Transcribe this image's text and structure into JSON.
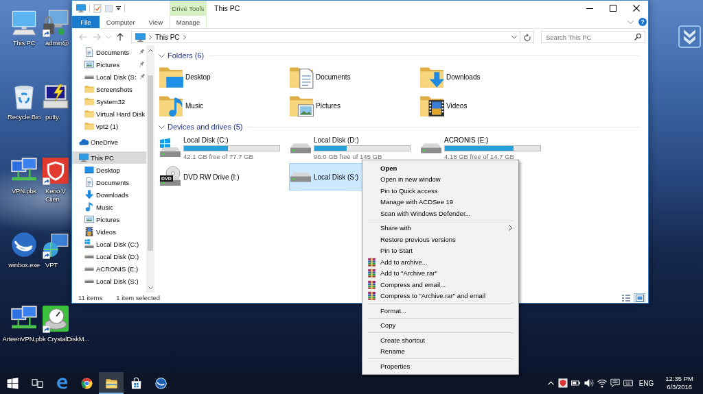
{
  "desktop": {
    "icons": [
      {
        "label": "This PC",
        "kind": "pc",
        "shortcut": false
      },
      {
        "label": "Recycle Bin",
        "kind": "recycle-bin",
        "shortcut": false
      },
      {
        "label": "VPN.pbk",
        "kind": "network",
        "shortcut": false
      },
      {
        "label": "winbox.exe",
        "kind": "winbox",
        "shortcut": false
      },
      {
        "label": "ArteenVPN.pbk",
        "kind": "network",
        "shortcut": false
      },
      {
        "label": "admin@",
        "kind": "remote",
        "shortcut": true
      },
      {
        "label": "putty.",
        "kind": "putty",
        "shortcut": false
      },
      {
        "label": "Kerio V Clien",
        "kind": "shield-app",
        "shortcut": true
      },
      {
        "label": "VPT",
        "kind": "globe-network",
        "shortcut": true
      },
      {
        "label": "CrystalDiskM...",
        "kind": "disk-gauge",
        "shortcut": true
      }
    ]
  },
  "window": {
    "title": "This PC",
    "ribbon": {
      "contextual_group": "Drive Tools",
      "tabs": [
        {
          "label": "File",
          "kind": "file",
          "selected": false
        },
        {
          "label": "Computer",
          "kind": "tab",
          "selected": false
        },
        {
          "label": "View",
          "kind": "tab",
          "selected": false
        },
        {
          "label": "Manage",
          "kind": "contextual",
          "selected": false
        }
      ],
      "help_button": "?"
    },
    "address_bar": {
      "buttons": [
        {
          "kind": "back",
          "disabled": true
        },
        {
          "kind": "forward",
          "disabled": true
        },
        {
          "kind": "recent",
          "disabled": true
        },
        {
          "kind": "up",
          "disabled": false
        }
      ],
      "path": [
        "This PC"
      ]
    },
    "search": {
      "placeholder": "Search This PC"
    },
    "navigation_pane": {
      "quick_access": [
        {
          "label": "Documents",
          "kind": "documents",
          "pinned": true,
          "selected": false
        },
        {
          "label": "Pictures",
          "kind": "pictures",
          "pinned": true,
          "selected": false
        },
        {
          "label": "Local Disk (S:",
          "kind": "drive",
          "pinned": true,
          "selected": false
        },
        {
          "label": "Screenshots",
          "kind": "folder",
          "pinned": false,
          "selected": false
        },
        {
          "label": "System32",
          "kind": "folder",
          "pinned": false,
          "selected": false
        },
        {
          "label": "Virtual Hard Disk",
          "kind": "folder",
          "pinned": false,
          "selected": false
        },
        {
          "label": "vpt2 (1)",
          "kind": "folder",
          "pinned": false,
          "selected": false
        }
      ],
      "tree": [
        {
          "label": "OneDrive",
          "kind": "onedrive",
          "selected": false
        },
        {
          "label": "This PC",
          "kind": "pc",
          "selected": true,
          "children": [
            {
              "label": "Desktop",
              "kind": "desktop",
              "selected": false
            },
            {
              "label": "Documents",
              "kind": "documents",
              "selected": false
            },
            {
              "label": "Downloads",
              "kind": "downloads",
              "selected": false
            },
            {
              "label": "Music",
              "kind": "music",
              "selected": false
            },
            {
              "label": "Pictures",
              "kind": "pictures",
              "selected": false
            },
            {
              "label": "Videos",
              "kind": "videos",
              "selected": false
            },
            {
              "label": "Local Disk (C:)",
              "kind": "windows-drive",
              "selected": false
            },
            {
              "label": "Local Disk (D:)",
              "kind": "drive",
              "selected": false
            },
            {
              "label": "ACRONIS (E:)",
              "kind": "drive",
              "selected": false
            },
            {
              "label": "Local Disk (S:)",
              "kind": "drive",
              "selected": false
            }
          ]
        }
      ]
    },
    "content": {
      "groups": [
        {
          "title": "Folders (6)",
          "kind": "folders",
          "expanded": true,
          "items": [
            {
              "label": "Desktop",
              "kind": "desktop"
            },
            {
              "label": "Documents",
              "kind": "documents"
            },
            {
              "label": "Downloads",
              "kind": "downloads"
            },
            {
              "label": "Music",
              "kind": "music"
            },
            {
              "label": "Pictures",
              "kind": "pictures"
            },
            {
              "label": "Videos",
              "kind": "videos"
            }
          ]
        },
        {
          "title": "Devices and drives (5)",
          "kind": "drives",
          "expanded": true,
          "items": [
            {
              "label": "Local Disk (C:)",
              "kind": "windows-drive",
              "level": 0.46,
              "free_space": "42.1 GB free of 77.7 GB",
              "selected": false
            },
            {
              "label": "Local Disk (D:)",
              "kind": "drive",
              "level": 0.34,
              "free_space": "96.0 GB free of 145 GB",
              "selected": false
            },
            {
              "label": "ACRONIS (E:)",
              "kind": "drive",
              "level": 0.72,
              "free_space": "4.18 GB free of 14.7 GB",
              "selected": false
            },
            {
              "label": "DVD RW Drive (I:)",
              "kind": "dvd",
              "badge": "DVD",
              "selected": false
            },
            {
              "label": "Local Disk (S:)",
              "kind": "drive",
              "selected": true
            }
          ]
        }
      ]
    },
    "status_bar": {
      "item_count": "11 items",
      "selection": "1 item selected",
      "views": [
        {
          "kind": "details",
          "selected": false
        },
        {
          "kind": "large-icons",
          "selected": true
        }
      ]
    }
  },
  "context_menu": {
    "groups": [
      [
        {
          "label": "Open",
          "kind": "default"
        },
        {
          "label": "Open in new window",
          "kind": "plain"
        },
        {
          "label": "Pin to Quick access",
          "kind": "plain"
        },
        {
          "label": "Manage with ACDSee 19",
          "kind": "plain"
        },
        {
          "label": "Scan with Windows Defender...",
          "kind": "plain"
        }
      ],
      [
        {
          "label": "Share with",
          "kind": "submenu"
        },
        {
          "label": "Restore previous versions",
          "kind": "plain"
        },
        {
          "label": "Pin to Start",
          "kind": "plain"
        },
        {
          "label": "Add to archive...",
          "kind": "archive"
        },
        {
          "label": "Add to \"Archive.rar\"",
          "kind": "archive"
        },
        {
          "label": "Compress and email...",
          "kind": "archive"
        },
        {
          "label": "Compress to \"Archive.rar\" and email",
          "kind": "archive"
        }
      ],
      [
        {
          "label": "Format...",
          "kind": "plain"
        }
      ],
      [
        {
          "label": "Copy",
          "kind": "plain"
        }
      ],
      [
        {
          "label": "Create shortcut",
          "kind": "plain"
        },
        {
          "label": "Rename",
          "kind": "plain"
        }
      ],
      [
        {
          "label": "Properties",
          "kind": "plain"
        }
      ]
    ]
  },
  "taskbar": {
    "buttons": [
      {
        "kind": "start",
        "active": false
      },
      {
        "kind": "task-view",
        "active": false
      },
      {
        "kind": "edge",
        "active": false
      },
      {
        "kind": "chrome",
        "active": false
      },
      {
        "kind": "explorer",
        "active": true
      },
      {
        "kind": "store",
        "active": false
      },
      {
        "kind": "app",
        "active": false
      }
    ],
    "tray": [
      {
        "kind": "chevron"
      },
      {
        "kind": "app-shield"
      },
      {
        "kind": "power"
      },
      {
        "kind": "volume"
      },
      {
        "kind": "network"
      },
      {
        "kind": "notifications"
      },
      {
        "kind": "keyboard"
      }
    ],
    "language": "ENG",
    "time": "12:35 PM",
    "date": "6/3/2016"
  }
}
